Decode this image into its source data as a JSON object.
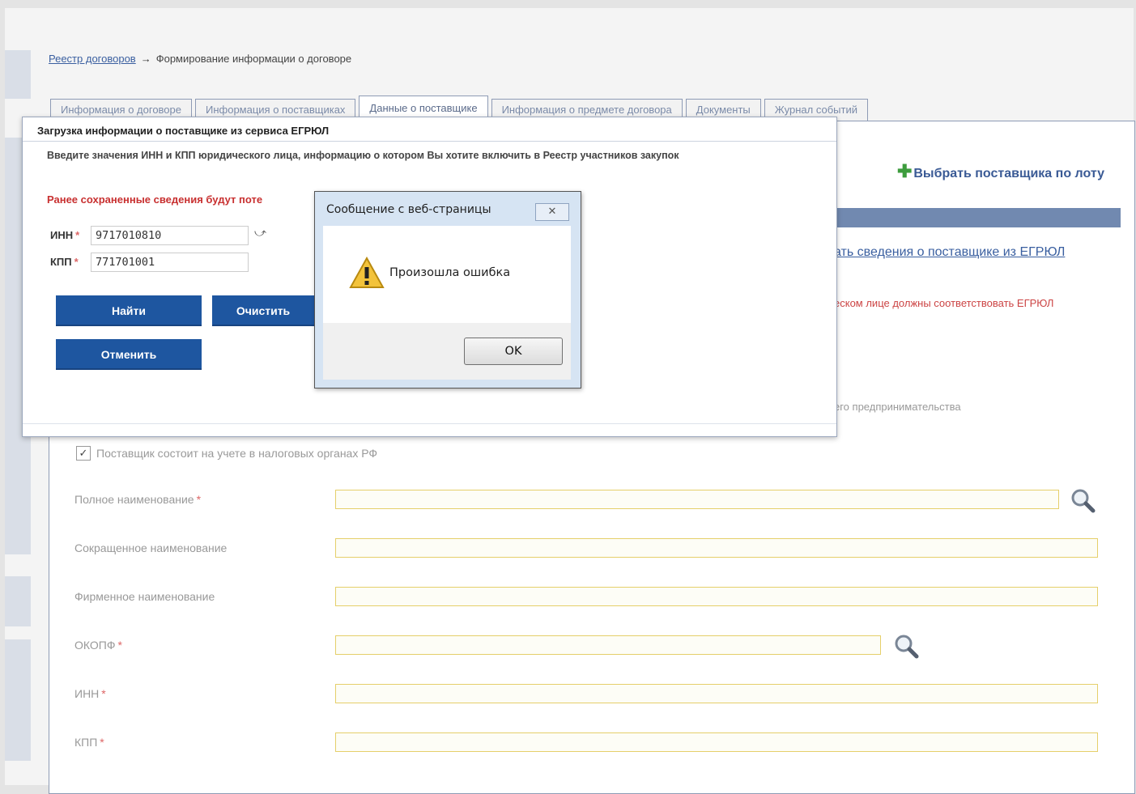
{
  "breadcrumb": {
    "registry_link": "Реестр договоров",
    "arrow": "→",
    "current": "Формирование информации о договоре"
  },
  "tabs": [
    {
      "label": "Информация о договоре",
      "active": false
    },
    {
      "label": "Информация о поставщиках",
      "active": false
    },
    {
      "label": "Данные о поставщике",
      "active": true
    },
    {
      "label": "Информация о предмете договора",
      "active": false
    },
    {
      "label": "Документы",
      "active": false
    },
    {
      "label": "Журнал событий",
      "active": false
    }
  ],
  "right_panel": {
    "choose_supplier": "Выбрать поставщика по лоту",
    "egrul_link_partial": "ать сведения о поставщике из ЕГРЮЛ",
    "egrul_note_partial": "еском лице должны соответствовать ЕГРЮЛ",
    "entrepreneur_partial": "его предпринимательства"
  },
  "form": {
    "tax_checkbox_label": "Поставщик состоит на учете в налоговых органах РФ",
    "tax_checkbox_checked": true,
    "fields": {
      "full_name": "Полное наименование",
      "short_name": "Сокращенное наименование",
      "brand_name": "Фирменное наименование",
      "okopf": "ОКОПФ",
      "inn": "ИНН",
      "kpp": "КПП"
    },
    "required_mark": "*"
  },
  "modal": {
    "title": "Загрузка информации о поставщике из сервиса ЕГРЮЛ",
    "description": "Введите значения ИНН и КПП юридического лица, информацию о котором Вы хотите включить в Реестр участников закупок",
    "warning_partial": "Ранее сохраненные сведения будут поте",
    "inn_label": "ИНН",
    "inn_value": "9717010810",
    "kpp_label": "КПП",
    "kpp_value": "771701001",
    "required_mark": "*",
    "find_button": "Найти",
    "clear_button_partial": "Очистить",
    "cancel_button": "Отменить"
  },
  "alert": {
    "title": "Сообщение с веб-страницы",
    "close_glyph": "✕",
    "message": "Произошла ошибка",
    "ok_button": "OK"
  },
  "colors": {
    "primary_button": "#1e56a0",
    "link": "#3a5fa0",
    "warning_red": "#c83030",
    "field_border": "#e5cf6a"
  }
}
